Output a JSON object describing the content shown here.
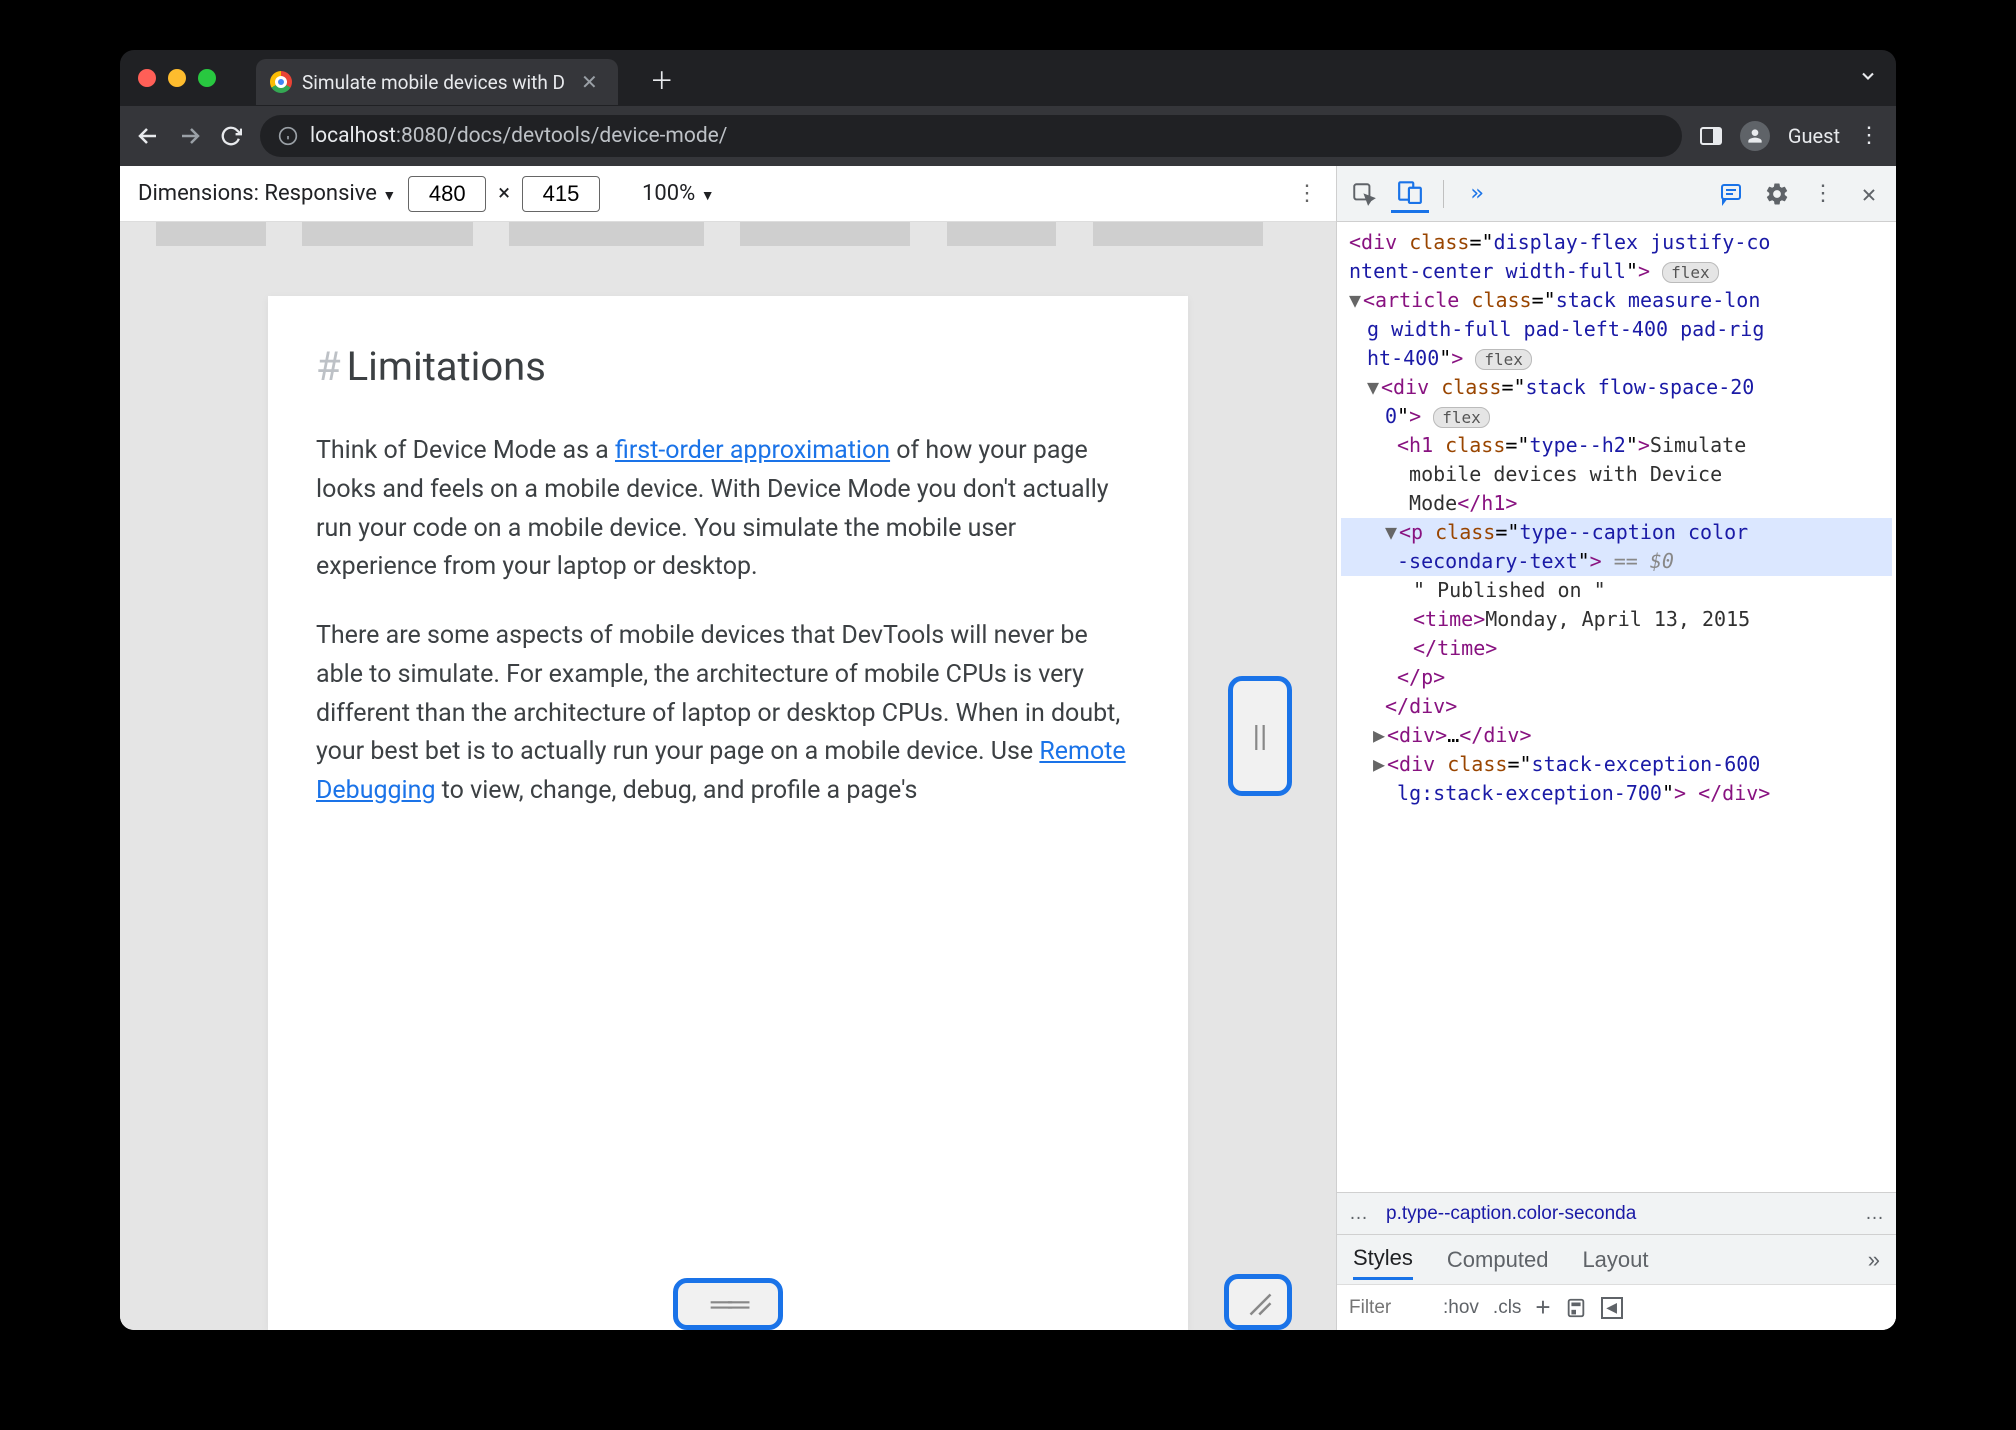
{
  "tab": {
    "title": "Simulate mobile devices with D"
  },
  "url": {
    "scheme_host": "localhost",
    "port_path": ":8080/docs/devtools/device-mode/"
  },
  "profile": "Guest",
  "device_bar": {
    "label": "Dimensions: Responsive",
    "width": "480",
    "height": "415",
    "sep": "×",
    "zoom": "100%"
  },
  "article": {
    "heading": "Limitations",
    "p1a": "Think of Device Mode as a ",
    "link1": "first-order approximation",
    "p1b": " of how your page looks and feels on a mobile device. With Device Mode you don't actually run your code on a mobile device. You simulate the mobile user experience from your laptop or desktop.",
    "p2a": "There are some aspects of mobile devices that DevTools will never be able to simulate. For example, the architecture of mobile CPUs is very different than the architecture of laptop or desktop CPUs. When in doubt, your best bet is to actually run your page on a mobile device. Use ",
    "link2": "Remote Debugging",
    "p2b": " to view, change, debug, and profile a page's"
  },
  "dom": {
    "l1": "<div class=\"display-flex justify-co",
    "l1b": "ntent-center width-full\">",
    "l2": "<article class=\"stack measure-lon",
    "l2b": "g width-full pad-left-400 pad-rig",
    "l2c": "ht-400\">",
    "l3": "<div class=\"stack flow-space-20",
    "l3b": "0\">",
    "l4": "<h1 class=\"type--h2\">Simulate",
    "l4b": " mobile devices with Device",
    "l4c": " Mode</h1>",
    "l5": "<p class=\"type--caption color",
    "l5b": "-secondary-text\">",
    "eq0": " == $0",
    "l6": "\" Published on \"",
    "l7": "<time>Monday, April 13, 2015",
    "l7b": "</time>",
    "l8": "</p>",
    "l9": "</div>",
    "l10": "<div>…</div>",
    "l11": "<div class=\"stack-exception-600",
    "l11b": " lg:stack-exception-700\"> </div>",
    "flex": "flex"
  },
  "crumbs": {
    "left": "…",
    "mid": "p.type--caption.color-seconda",
    "right": "…"
  },
  "styles_tabs": {
    "t1": "Styles",
    "t2": "Computed",
    "t3": "Layout"
  },
  "styles_bar": {
    "filter": "Filter",
    "hov": ":hov",
    "cls": ".cls"
  }
}
